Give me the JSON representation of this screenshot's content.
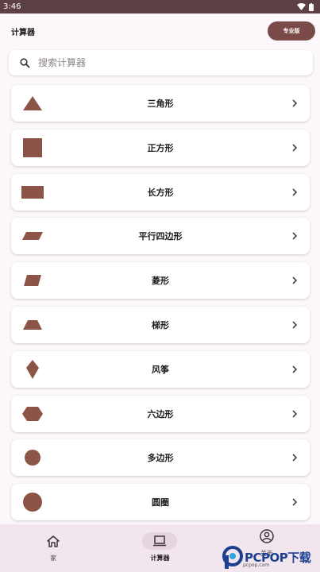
{
  "status_bar": {
    "time": "3:46"
  },
  "app_bar": {
    "title": "计算器",
    "pro_label": "专业版"
  },
  "search": {
    "placeholder": "搜索计算器"
  },
  "shapes": [
    {
      "label": "三角形",
      "icon": "triangle-icon"
    },
    {
      "label": "正方形",
      "icon": "square-icon"
    },
    {
      "label": "长方形",
      "icon": "rectangle-icon"
    },
    {
      "label": "平行四边形",
      "icon": "parallelogram-icon"
    },
    {
      "label": "菱形",
      "icon": "rhombus-icon"
    },
    {
      "label": "梯形",
      "icon": "trapezoid-icon"
    },
    {
      "label": "风筝",
      "icon": "kite-icon"
    },
    {
      "label": "六边形",
      "icon": "hexagon-icon"
    },
    {
      "label": "多边形",
      "icon": "polygon-icon"
    },
    {
      "label": "圆圈",
      "icon": "circle-icon"
    }
  ],
  "bottom_nav": [
    {
      "label": "家",
      "icon": "home-icon",
      "active": false
    },
    {
      "label": "计算器",
      "icon": "laptop-icon",
      "active": true
    },
    {
      "label": "关于",
      "icon": "account-icon",
      "active": false
    }
  ],
  "watermark": {
    "brand": "PCPOP下载",
    "sub": "pcpop.com"
  },
  "colors": {
    "shape": "#8b5446",
    "accent": "#7a4a48",
    "status_bar": "#5c4046",
    "nav_bg": "#f1e6ee"
  }
}
